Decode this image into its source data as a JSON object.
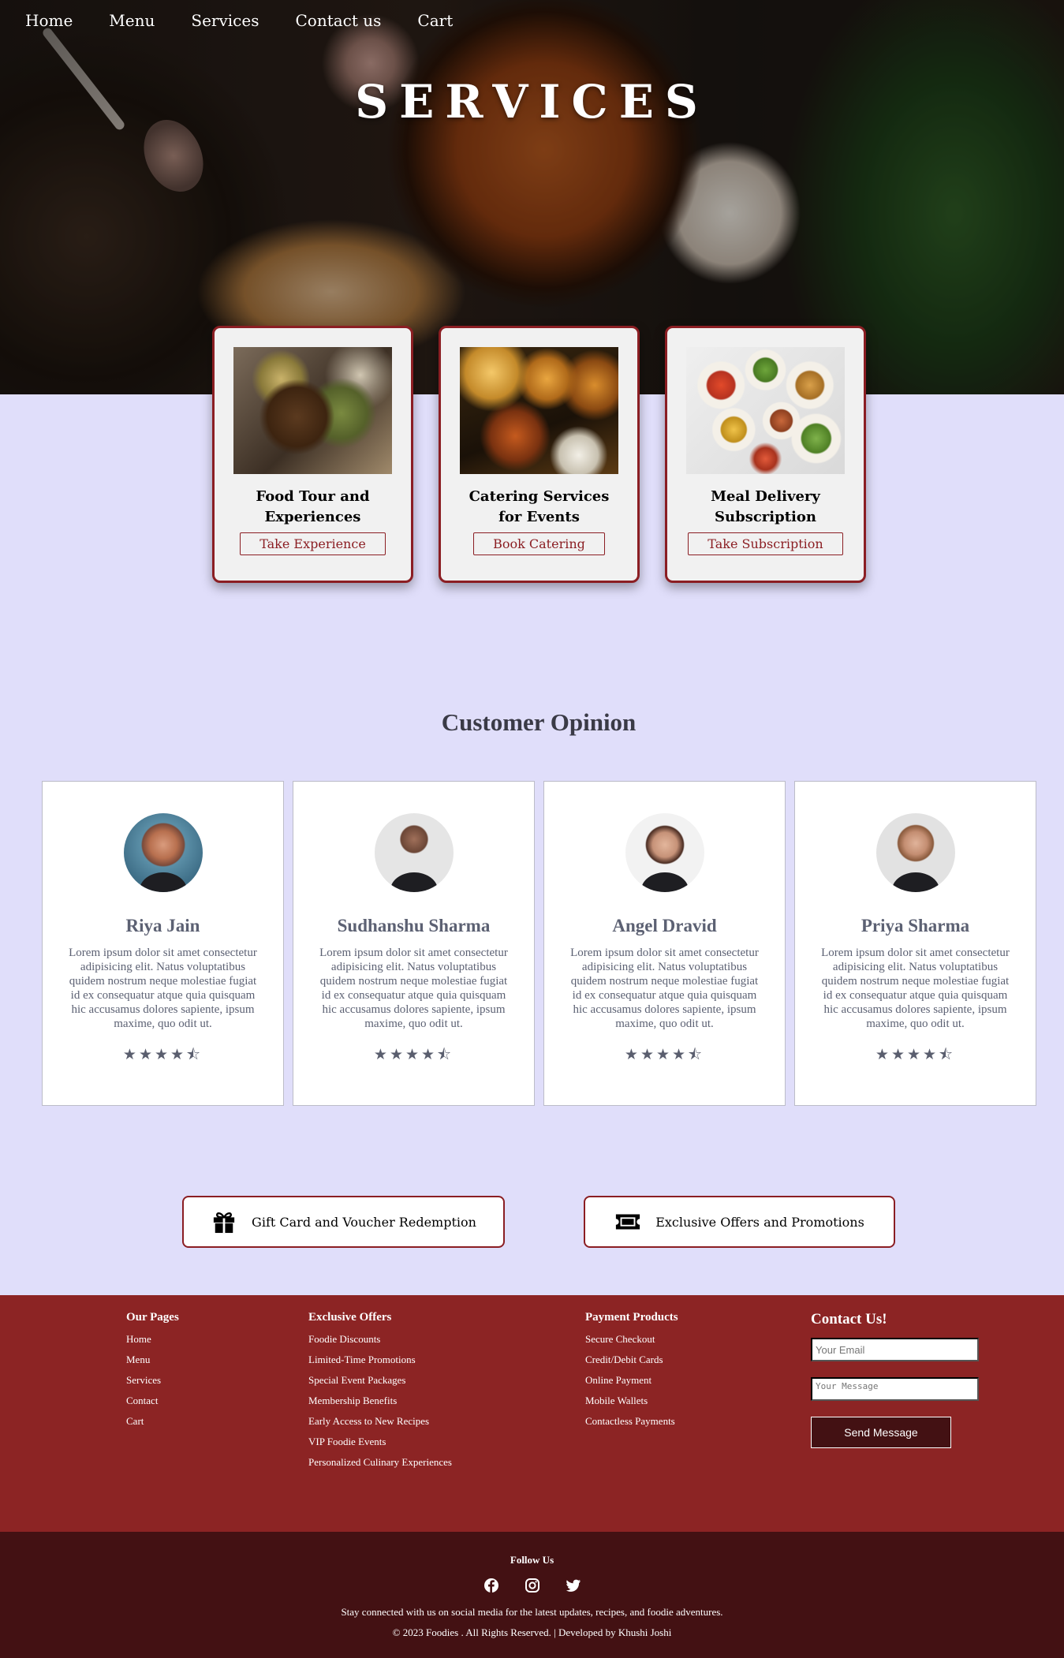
{
  "nav": {
    "items": [
      "Home",
      "Menu",
      "Services",
      "Contact us",
      "Cart"
    ]
  },
  "hero": {
    "title": "SERVICES"
  },
  "services": [
    {
      "title": "Food Tour and Experiences",
      "button": "Take Experience",
      "image": "food-tour-image"
    },
    {
      "title": "Catering Services for Events",
      "button": "Book Catering",
      "image": "catering-image"
    },
    {
      "title": "Meal Delivery Subscription",
      "button": "Take Subscription",
      "image": "meal-delivery-image"
    }
  ],
  "opinion": {
    "title": "Customer Opinion",
    "reviews": [
      {
        "name": "Riya Jain",
        "text": "Lorem ipsum dolor sit amet consectetur adipisicing elit. Natus voluptatibus quidem nostrum neque molestiae fugiat id ex consequatur atque quia quisquam hic accusamus dolores sapiente, ipsum maxime, quo odit ut.",
        "rating": 4.5
      },
      {
        "name": "Sudhanshu Sharma",
        "text": "Lorem ipsum dolor sit amet consectetur adipisicing elit. Natus voluptatibus quidem nostrum neque molestiae fugiat id ex consequatur atque quia quisquam hic accusamus dolores sapiente, ipsum maxime, quo odit ut.",
        "rating": 4.5
      },
      {
        "name": "Angel Dravid",
        "text": "Lorem ipsum dolor sit amet consectetur adipisicing elit. Natus voluptatibus quidem nostrum neque molestiae fugiat id ex consequatur atque quia quisquam hic accusamus dolores sapiente, ipsum maxime, quo odit ut.",
        "rating": 4.5
      },
      {
        "name": "Priya Sharma",
        "text": "Lorem ipsum dolor sit amet consectetur adipisicing elit. Natus voluptatibus quidem nostrum neque molestiae fugiat id ex consequatur atque quia quisquam hic accusamus dolores sapiente, ipsum maxime, quo odit ut.",
        "rating": 4.5
      }
    ],
    "stars_display": "★★★★⯪"
  },
  "offers": {
    "gift": "Gift Card and Voucher Redemption",
    "promo": "Exclusive Offers and Promotions"
  },
  "footer": {
    "pages": {
      "heading": "Our Pages",
      "links": [
        "Home",
        "Menu",
        "Services",
        "Contact",
        "Cart"
      ]
    },
    "exclusive": {
      "heading": "Exclusive Offers",
      "links": [
        "Foodie Discounts",
        "Limited-Time Promotions",
        "Special Event Packages",
        "Membership Benefits",
        "Early Access to New Recipes",
        "VIP Foodie Events",
        "Personalized Culinary Experiences"
      ]
    },
    "payment": {
      "heading": "Payment Products",
      "links": [
        "Secure Checkout",
        "Credit/Debit Cards",
        "Online Payment",
        "Mobile Wallets",
        "Contactless Payments"
      ]
    },
    "contact": {
      "heading": "Contact Us!",
      "email_placeholder": "Your Email",
      "message_placeholder": "Your Message",
      "send_label": "Send Message"
    },
    "follow": "Follow Us",
    "socials": [
      "facebook-icon",
      "instagram-icon",
      "twitter-icon"
    ],
    "stay": "Stay connected with us on social media for the latest updates, recipes, and foodie adventures.",
    "copyright": "© 2023 Foodies . All Rights Reserved. | Developed by Khushi Joshi"
  },
  "colors": {
    "accent": "#8b1e23",
    "page_bg": "#e0defa",
    "footer": "#8c2424",
    "footer_dark": "#431113"
  }
}
